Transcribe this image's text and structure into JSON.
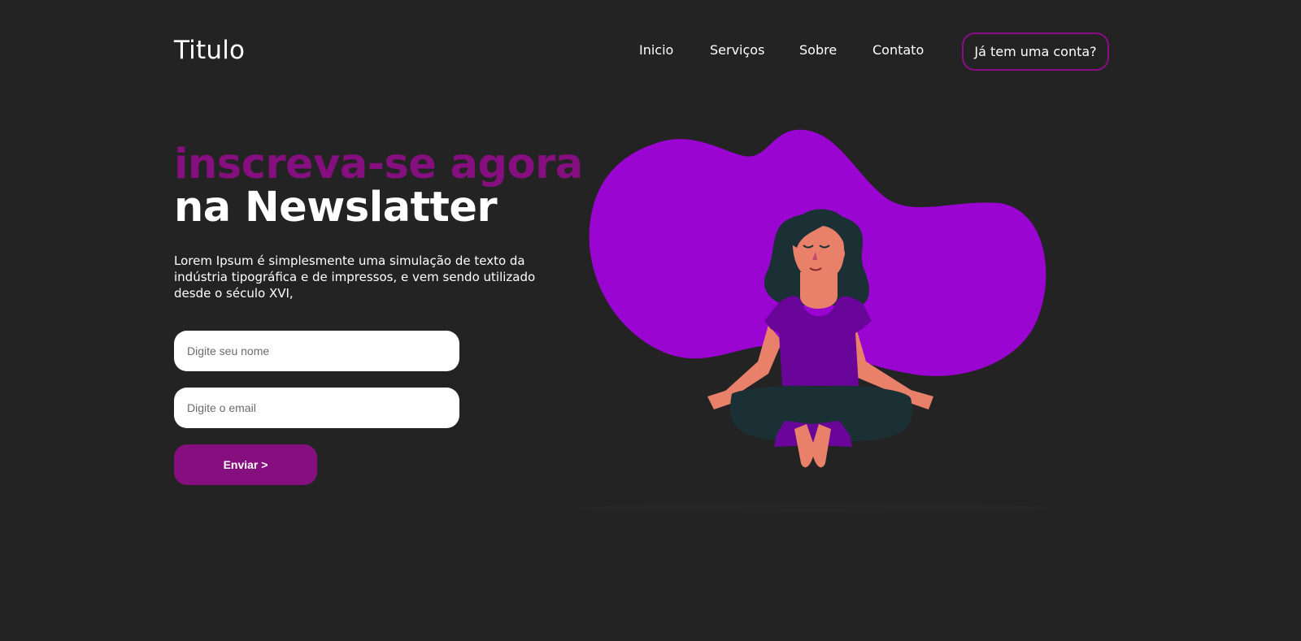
{
  "header": {
    "brand": "Titulo",
    "nav": [
      {
        "label": "Inicio"
      },
      {
        "label": "Serviços"
      },
      {
        "label": "Sobre"
      },
      {
        "label": "Contato"
      }
    ],
    "account_button": "Já tem uma conta?"
  },
  "hero": {
    "title_line1": "inscreva-se agora",
    "title_line2": "na Newslatter",
    "description": "Lorem Ipsum é simplesmente uma simulação de texto da indústria tipográfica e de impressos, e vem sendo utilizado desde o século XVI,"
  },
  "form": {
    "name_placeholder": "Digite seu nome",
    "name_value": "",
    "email_placeholder": "Digite o email",
    "email_value": "",
    "submit_label": "Enviar >"
  },
  "colors": {
    "background": "#232323",
    "accent": "#860f7f",
    "blob": "#9b05d1",
    "skin": "#e8806a",
    "hair": "#1b3035",
    "shirt": "#6a0599"
  },
  "illustration": {
    "icon": "meditating-woman-illustration"
  }
}
